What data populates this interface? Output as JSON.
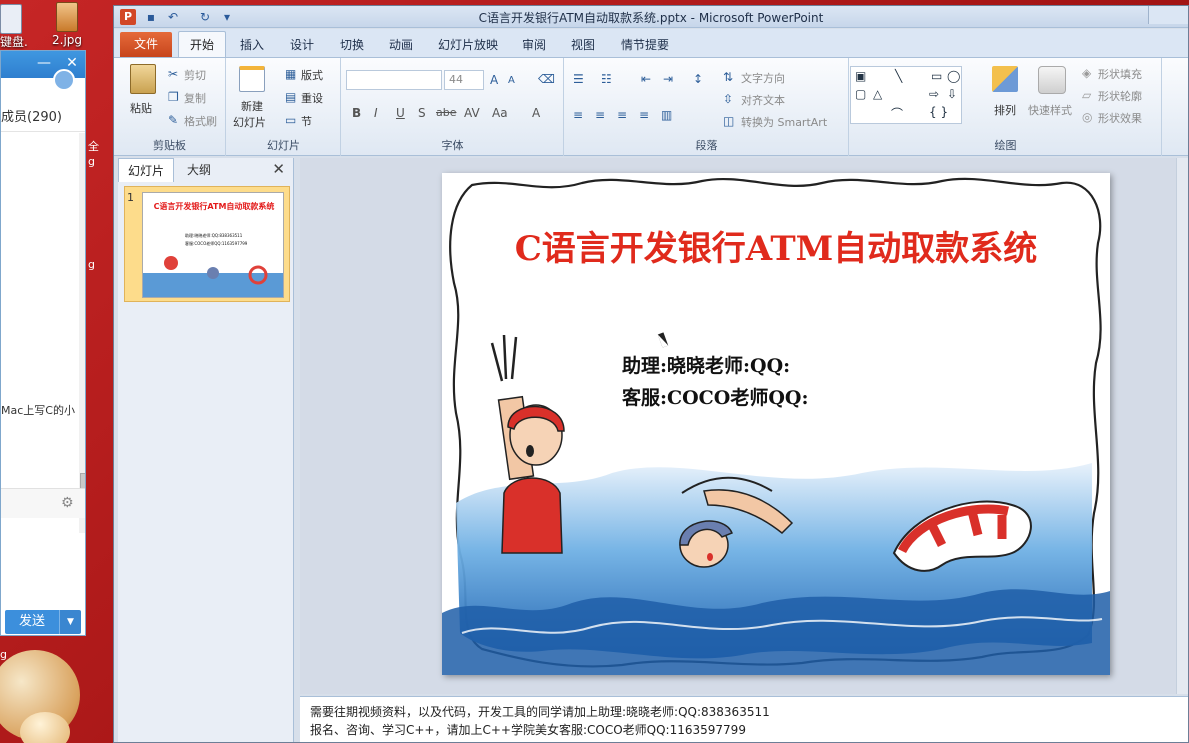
{
  "desktop": {
    "icon_labels": [
      "键盘.",
      "2.jpg"
    ],
    "edge_texts": [
      "全",
      "g",
      "g",
      "g"
    ]
  },
  "chat": {
    "members": "成员(290)",
    "message_fragment": "Mac上写C的小",
    "send_label": "发送",
    "send_dropdown": "▼",
    "minimize": "—",
    "close": "✕"
  },
  "ppt": {
    "window_title": "C语言开发银行ATM自动取款系统.pptx - Microsoft PowerPoint",
    "app_icon": "P",
    "tabs": {
      "file": "文件",
      "active": "开始",
      "others": [
        "插入",
        "设计",
        "切换",
        "动画",
        "幻灯片放映",
        "审阅",
        "视图",
        "情节提要"
      ]
    },
    "clipboard": {
      "paste": "粘贴",
      "cut": "剪切",
      "copy": "复制",
      "format_painter": "格式刷",
      "label": "剪贴板"
    },
    "slides_group": {
      "new_slide_1": "新建",
      "new_slide_2": "幻灯片",
      "layout": "版式",
      "reset": "重设",
      "section": "节",
      "label": "幻灯片"
    },
    "font": {
      "size": "44",
      "bold": "B",
      "italic": "I",
      "underline": "U",
      "strike": "S",
      "abc": "abe",
      "aa": "Aa",
      "label": "字体"
    },
    "paragraph": {
      "text_direction": "文字方向",
      "align_text": "对齐文本",
      "smartart": "转换为 SmartArt",
      "label": "段落"
    },
    "drawing": {
      "arrange": "排列",
      "quick_styles": "快速样式",
      "shape_fill": "形状填充",
      "shape_outline": "形状轮廓",
      "shape_effects": "形状效果",
      "label": "绘图"
    }
  },
  "panel": {
    "tab_slides": "幻灯片",
    "tab_outline": "大纲",
    "close": "✕",
    "slide_number": "1",
    "thumb_title": "C语言开发银行ATM自动取款系统",
    "thumb_line1": "助理:晓晓老师:QQ:838363511",
    "thumb_line2": "客服:COCO老师QQ:1163597799"
  },
  "slide": {
    "title": "C语言开发银行ATM自动取款系统",
    "line1": "助理:晓晓老师:QQ:",
    "line2": "客服:COCO老师QQ:"
  },
  "notes": {
    "line1": "需要往期视频资料，以及代码，开发工具的同学请加上助理:晓晓老师:QQ:838363511",
    "line2": "报名、咨询、学习C++，请加上C++学院美女客服:COCO老师QQ:1163597799"
  },
  "colors": {
    "desktop": "#b21f1f",
    "ppt_accent": "#c7451c",
    "title_red": "#e02a1c",
    "chat_blue": "#3c8fdc"
  },
  "icons": {
    "app": "powerpoint-icon",
    "settings": "gear-icon"
  }
}
